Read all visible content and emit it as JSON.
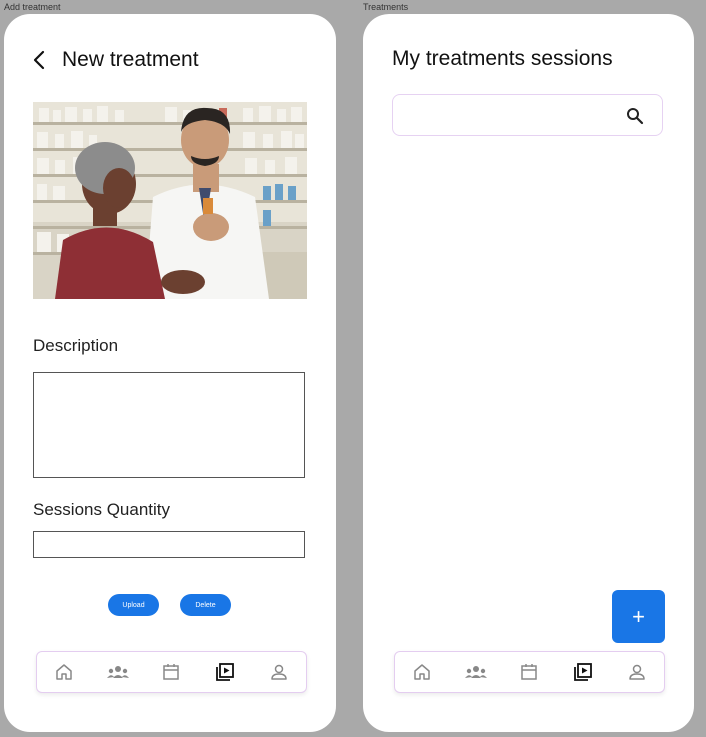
{
  "frames": {
    "left_label": "Add treatment",
    "right_label": "Treatments"
  },
  "add_treatment": {
    "title": "New treatment",
    "description_label": "Description",
    "description_value": "",
    "sessions_label": "Sessions Quantity",
    "sessions_value": "",
    "upload_label": "Upload",
    "delete_label": "Delete"
  },
  "treatments": {
    "title": "My treatments sessions",
    "search_value": "",
    "fab_label": "+"
  },
  "nav": {
    "items": [
      "home-icon",
      "community-icon",
      "calendar-icon",
      "video-library-icon",
      "profile-icon"
    ],
    "active": "video-library-icon"
  },
  "colors": {
    "accent": "#1976e6",
    "background": "#a9a9a9",
    "nav_border": "#e4cdf0"
  }
}
